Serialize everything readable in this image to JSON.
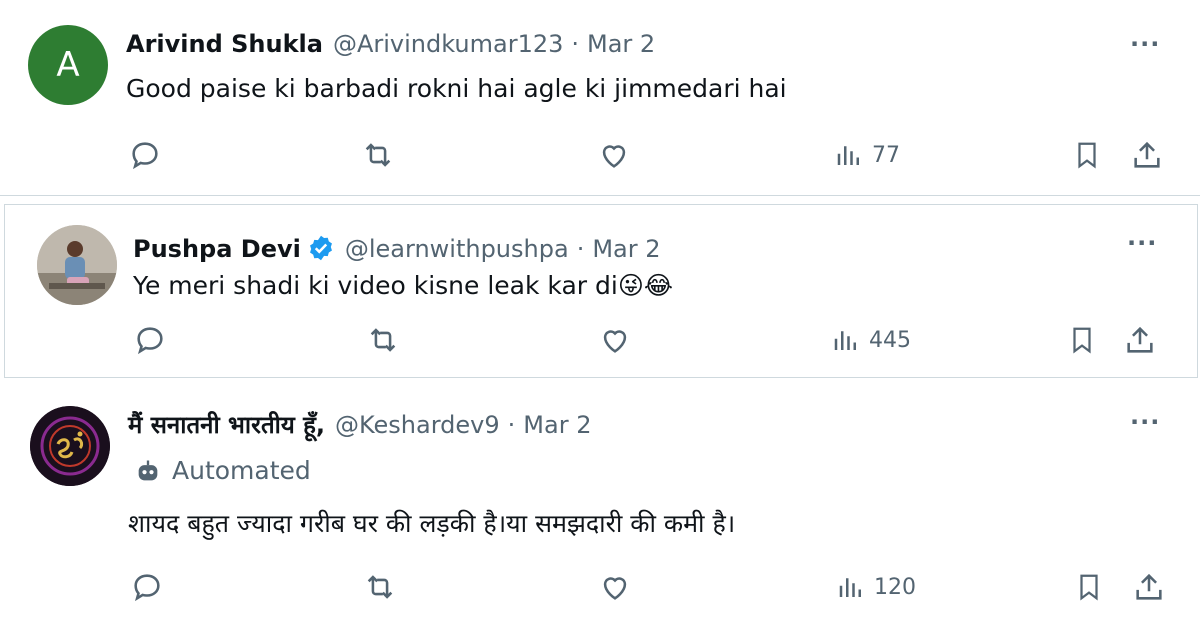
{
  "tweets": [
    {
      "avatar_letter": "A",
      "avatar_color": "#2e7d32",
      "name": "Arivind Shukla",
      "handle": "@Arivindkumar123",
      "separator": "·",
      "date": "Mar 2",
      "text": "Good paise ki barbadi rokni hai agle ki jimmedari hai",
      "views": "77"
    },
    {
      "name": "Pushpa Devi",
      "verified": true,
      "handle": "@learnwithpushpa",
      "separator": "·",
      "date": "Mar 2",
      "text": "Ye meri shadi ki video kisne leak kar di😜😂",
      "views": "445"
    },
    {
      "name": "मैं सनातनी भारतीय हूँ,",
      "handle": "@Keshardev9",
      "separator": "·",
      "date": "Mar 2",
      "automated_label": "Automated",
      "text": "शायद बहुत ज्यादा गरीब घर की लड़की है।या समझदारी की कमी है।",
      "views": "120"
    }
  ],
  "more_label": "···",
  "colors": {
    "muted": "#536471",
    "verified_blue": "#1d9bf0",
    "border": "#cfd9de"
  }
}
